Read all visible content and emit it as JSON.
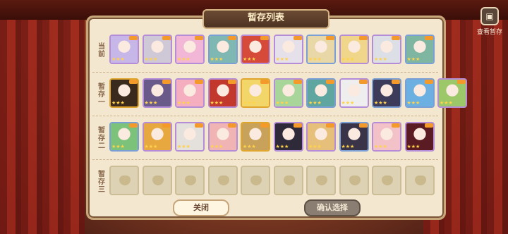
{
  "title": "暂存列表",
  "side_button": {
    "icon": "box-icon",
    "label": "查看暂存"
  },
  "rows": [
    {
      "label": "当前",
      "slots": [
        {
          "bg": "#c7b6e8",
          "frame": "#b48cd8"
        },
        {
          "bg": "#cfc8d6",
          "frame": "#b48cd8"
        },
        {
          "bg": "#f2b7d6",
          "frame": "#b48cd8"
        },
        {
          "bg": "#7fb7b3",
          "frame": "#7a9fd6"
        },
        {
          "bg": "#d64a3a",
          "frame": "#b48cd8"
        },
        {
          "bg": "#e6e0ea",
          "frame": "#b48cd8"
        },
        {
          "bg": "#e8d8a8",
          "frame": "#7a9fd6"
        },
        {
          "bg": "#f0d68a",
          "frame": "#b48cd8"
        },
        {
          "bg": "#dcdfe6",
          "frame": "#b48cd8"
        },
        {
          "bg": "#7fb6a2",
          "frame": "#7a9fd6"
        }
      ]
    },
    {
      "label": "暂存一",
      "slots": [
        {
          "bg": "#3a2a1e",
          "frame": "#e0a52c"
        },
        {
          "bg": "#6a5a8a",
          "frame": "#b48cd8"
        },
        {
          "bg": "#f4aec0",
          "frame": "#b48cd8"
        },
        {
          "bg": "#c2382c",
          "frame": "#b48cd8"
        },
        {
          "bg": "#f2d66a",
          "frame": "#e0a52c"
        },
        {
          "bg": "#a7d59a",
          "frame": "#b48cd8"
        },
        {
          "bg": "#5fa6a0",
          "frame": "#7a9fd6"
        },
        {
          "bg": "#eeeeee",
          "frame": "#b48cd8"
        },
        {
          "bg": "#3c3c5a",
          "frame": "#7a9fd6"
        },
        {
          "bg": "#6bb0e0",
          "frame": "#7a9fd6"
        },
        {
          "bg": "#9cc86a",
          "frame": "#b48cd8"
        }
      ]
    },
    {
      "label": "暂存二",
      "slots": [
        {
          "bg": "#7cc27a",
          "frame": "#7a9fd6"
        },
        {
          "bg": "#e8a840",
          "frame": "#b48cd8"
        },
        {
          "bg": "#e4e0dc",
          "frame": "#b48cd8"
        },
        {
          "bg": "#f0b4b4",
          "frame": "#b48cd8"
        },
        {
          "bg": "#c8a25a",
          "frame": "#e0a52c"
        },
        {
          "bg": "#2e2a3a",
          "frame": "#b48cd8"
        },
        {
          "bg": "#e6c07a",
          "frame": "#b48cd8"
        },
        {
          "bg": "#3a3448",
          "frame": "#7a9fd6"
        },
        {
          "bg": "#f2c2c8",
          "frame": "#b48cd8"
        },
        {
          "bg": "#5a1c22",
          "frame": "#b48cd8"
        }
      ]
    },
    {
      "label": "暂存三",
      "slots": [
        {
          "empty": true
        },
        {
          "empty": true
        },
        {
          "empty": true
        },
        {
          "empty": true
        },
        {
          "empty": true
        },
        {
          "empty": true
        },
        {
          "empty": true
        },
        {
          "empty": true
        },
        {
          "empty": true
        },
        {
          "empty": true
        }
      ]
    }
  ],
  "buttons": {
    "close": "关闭",
    "confirm": "确认选择"
  },
  "colors": {
    "panel": "#f3e7cf",
    "banner": "#5a3c28",
    "accent": "#b48cd8"
  }
}
